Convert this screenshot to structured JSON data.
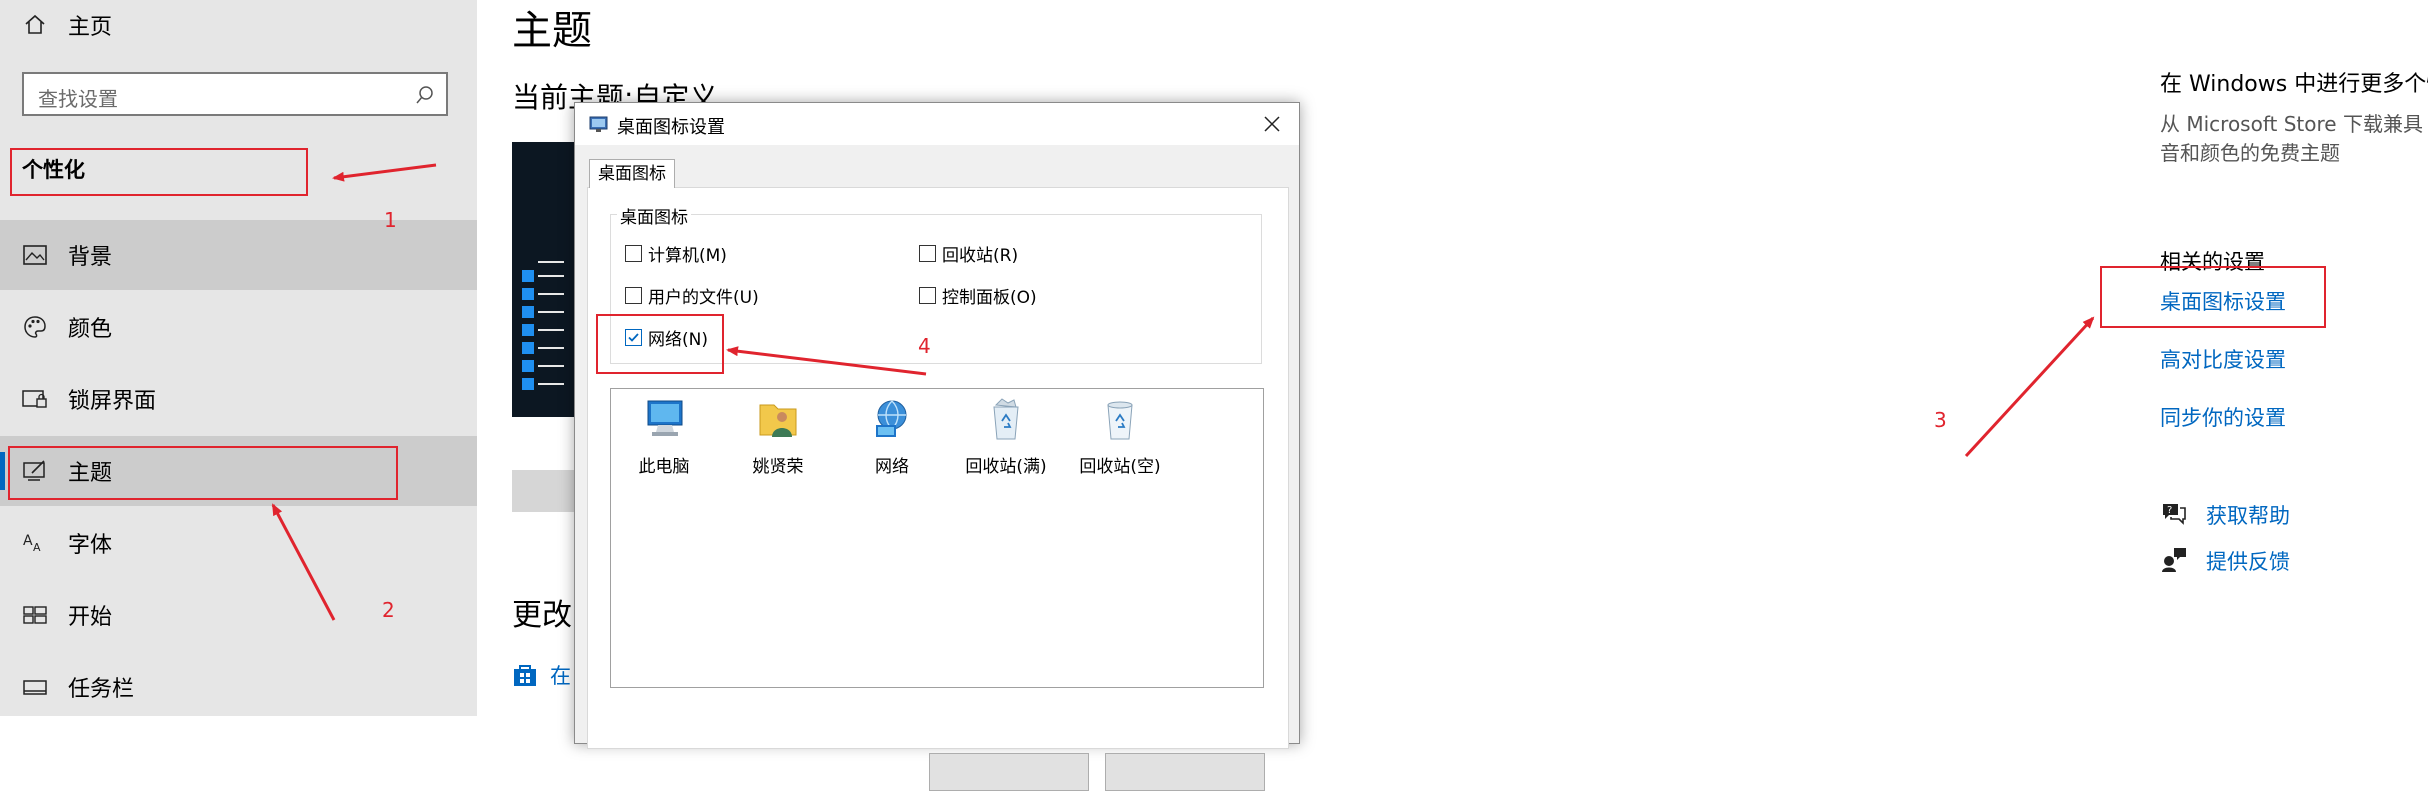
{
  "sidebar": {
    "home_label": "主页",
    "search_placeholder": "查找设置",
    "section_title": "个性化",
    "items": [
      {
        "label": "背景",
        "icon": "picture-icon"
      },
      {
        "label": "颜色",
        "icon": "palette-icon"
      },
      {
        "label": "锁屏界面",
        "icon": "lock-screen-icon"
      },
      {
        "label": "主题",
        "icon": "theme-icon"
      },
      {
        "label": "字体",
        "icon": "font-icon"
      },
      {
        "label": "开始",
        "icon": "start-icon"
      },
      {
        "label": "任务栏",
        "icon": "taskbar-icon"
      }
    ]
  },
  "main": {
    "title": "主题",
    "current_theme": "当前主题:自定义",
    "change_heading": "更改",
    "store_link_partial": "在"
  },
  "right_panel": {
    "heading": "在 Windows 中进行更多个性",
    "desc_line1": "从 Microsoft Store 下载兼具",
    "desc_line2": "音和颜色的免费主题",
    "related_title": "相关的设置",
    "links": [
      "桌面图标设置",
      "高对比度设置",
      "同步你的设置"
    ],
    "help_label": "获取帮助",
    "feedback_label": "提供反馈"
  },
  "dialog": {
    "title": "桌面图标设置",
    "tab": "桌面图标",
    "group_label": "桌面图标",
    "checkboxes": [
      {
        "label": "计算机(M)",
        "checked": false
      },
      {
        "label": "回收站(R)",
        "checked": false
      },
      {
        "label": "用户的文件(U)",
        "checked": false
      },
      {
        "label": "控制面板(O)",
        "checked": false
      },
      {
        "label": "网络(N)",
        "checked": true
      }
    ],
    "icons": [
      "此电脑",
      "姚贤荣",
      "网络",
      "回收站(满)",
      "回收站(空)"
    ]
  },
  "annotations": {
    "labels": [
      "1",
      "2",
      "3",
      "4"
    ],
    "color": "#e0242e"
  },
  "colors": {
    "accent": "#0067c0",
    "sidebar_bg": "#e6e6e6",
    "selected_bg": "#cccccc"
  }
}
